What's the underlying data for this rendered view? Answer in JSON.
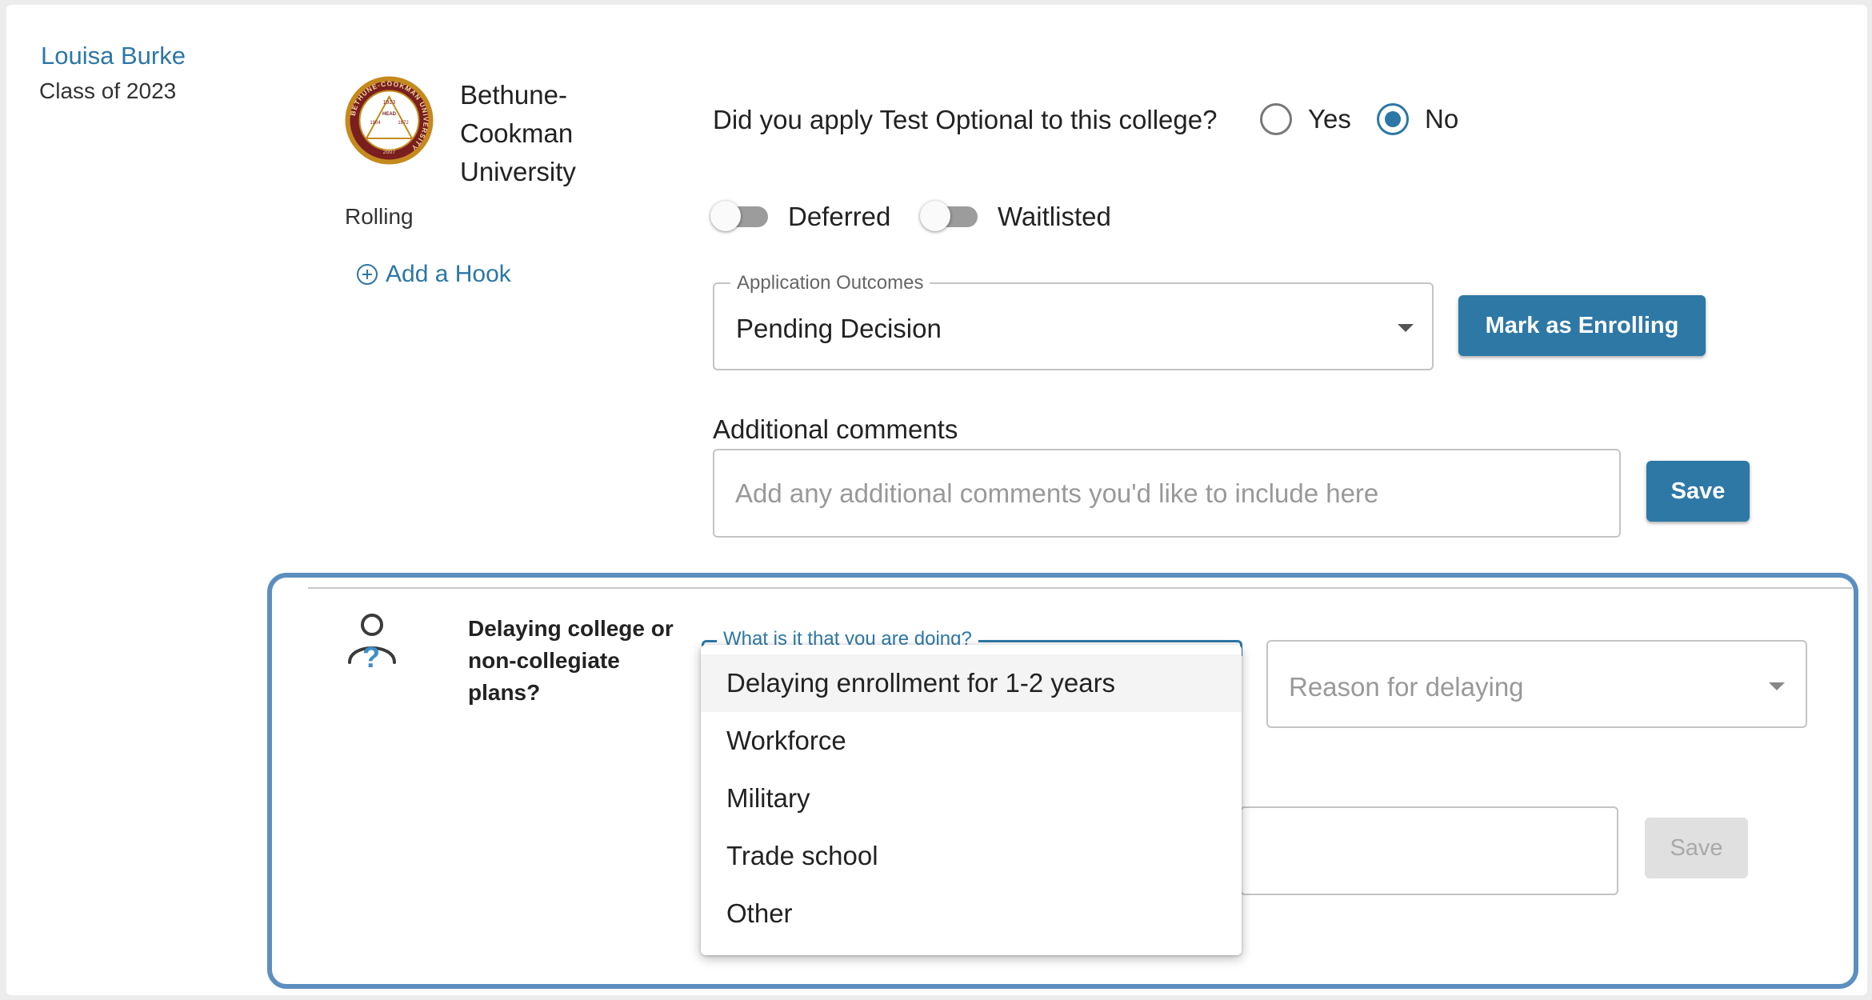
{
  "student": {
    "name": "Louisa Burke",
    "class_year": "Class of 2023"
  },
  "college": {
    "name": "Bethune-Cookman University",
    "name_lines": [
      "Bethune-",
      "Cookman",
      "University"
    ],
    "deadline_type": "Rolling",
    "add_hook_label": "Add a Hook",
    "logo_text": "BETHUNE-COOKMAN UNIVERSITY",
    "logo_years": [
      "1923",
      "1904",
      "1872",
      "2007"
    ],
    "logo_center": "HEAD"
  },
  "test_optional": {
    "question": "Did you apply Test Optional to this college?",
    "options": [
      {
        "label": "Yes",
        "checked": false
      },
      {
        "label": "No",
        "checked": true
      }
    ]
  },
  "toggles": [
    {
      "label": "Deferred",
      "on": false
    },
    {
      "label": "Waitlisted",
      "on": false
    }
  ],
  "application_outcome": {
    "legend": "Application Outcomes",
    "value": "Pending Decision",
    "enroll_button": "Mark as Enrolling"
  },
  "comments": {
    "label": "Additional comments",
    "placeholder": "Add any additional comments you'd like to include here",
    "save_button": "Save"
  },
  "delaying": {
    "title": "Delaying college or non-collegiate plans?",
    "what_legend": "What is it that you are doing?",
    "reason_placeholder": "Reason for delaying",
    "save_button": "Save",
    "menu_options": [
      "Delaying enrollment for 1-2 years",
      "Workforce",
      "Military",
      "Trade school",
      "Other"
    ],
    "highlighted_option": 0
  },
  "colors": {
    "accent": "#2e78a6",
    "link": "#2c77a7",
    "panel_border": "#5c8fbf",
    "logo_gold": "#c58a1e",
    "logo_maroon": "#7a1f1f"
  }
}
